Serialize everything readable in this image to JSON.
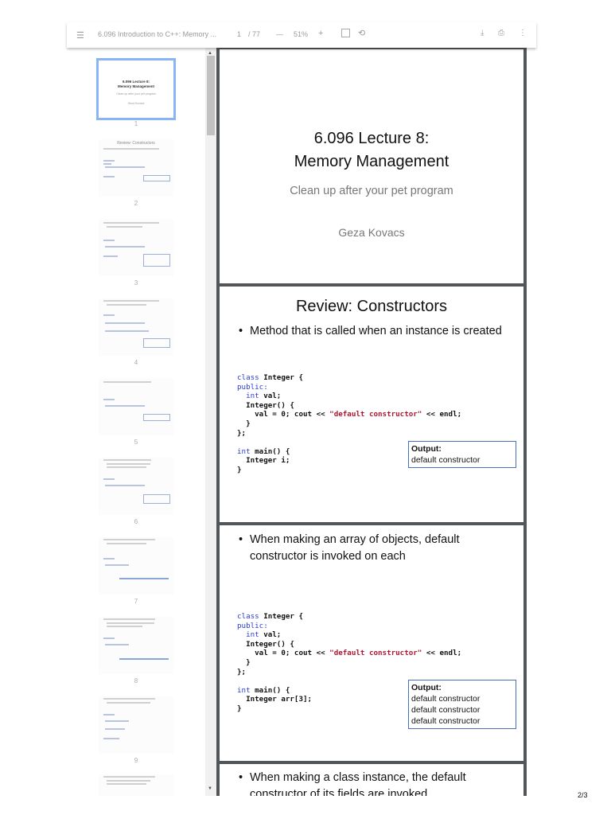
{
  "toolbar": {
    "menu_icon": "menu-icon",
    "doc_title": "6.096 Introduction to C++: Memory ...",
    "page_current": "1",
    "page_total": "/ 77",
    "zoom_out": "—",
    "zoom_level": "51%",
    "zoom_in": "+",
    "fit_icon": "fit-page-icon",
    "rotate_icon": "rotate-icon",
    "download_icon": "download-icon",
    "print_icon": "print-icon",
    "more_icon": "more-icon"
  },
  "thumbnails": [
    {
      "num": "1",
      "line1": "6.096 Lecture 8:",
      "line2": "Memory Management",
      "line3": "Clean up after your pet program",
      "line4": "Geza Kovacs"
    },
    {
      "num": "2",
      "title": "Review: Constructors"
    },
    {
      "num": "3"
    },
    {
      "num": "4"
    },
    {
      "num": "5"
    },
    {
      "num": "6"
    },
    {
      "num": "7"
    },
    {
      "num": "8"
    },
    {
      "num": "9"
    }
  ],
  "slides": {
    "s1": {
      "title1": "6.096 Lecture 8:",
      "title2": "Memory Management",
      "subtitle": "Clean up after your pet program",
      "author": "Geza Kovacs"
    },
    "s2": {
      "title": "Review: Constructors",
      "bullet": "Method that is called when an instance is created",
      "output_label": "Output:",
      "output": [
        "default constructor"
      ],
      "main_line": "  Integer i;"
    },
    "s3": {
      "bullet": "When making an array of objects, default constructor is invoked on each",
      "output_label": "Output:",
      "output": [
        "default constructor",
        "default constructor",
        "default constructor"
      ],
      "main_line": "  Integer arr[3];"
    },
    "s4": {
      "bullet": "When making a class instance, the default constructor of its fields are invoked"
    }
  },
  "code": {
    "kw_class": "class",
    "l1": " Integer {",
    "kw_public": "public:",
    "kw_int": "  int",
    "l3": " val;",
    "l4": "  Integer() {",
    "l5a": "    val = 0; cout << ",
    "l5s": "\"default constructor\"",
    "l5b": " << endl;",
    "l6": "  }",
    "l7": "};",
    "kw_int2": "int",
    "l8": " main() {",
    "l9": "}"
  },
  "footer": {
    "page": "2/3"
  }
}
